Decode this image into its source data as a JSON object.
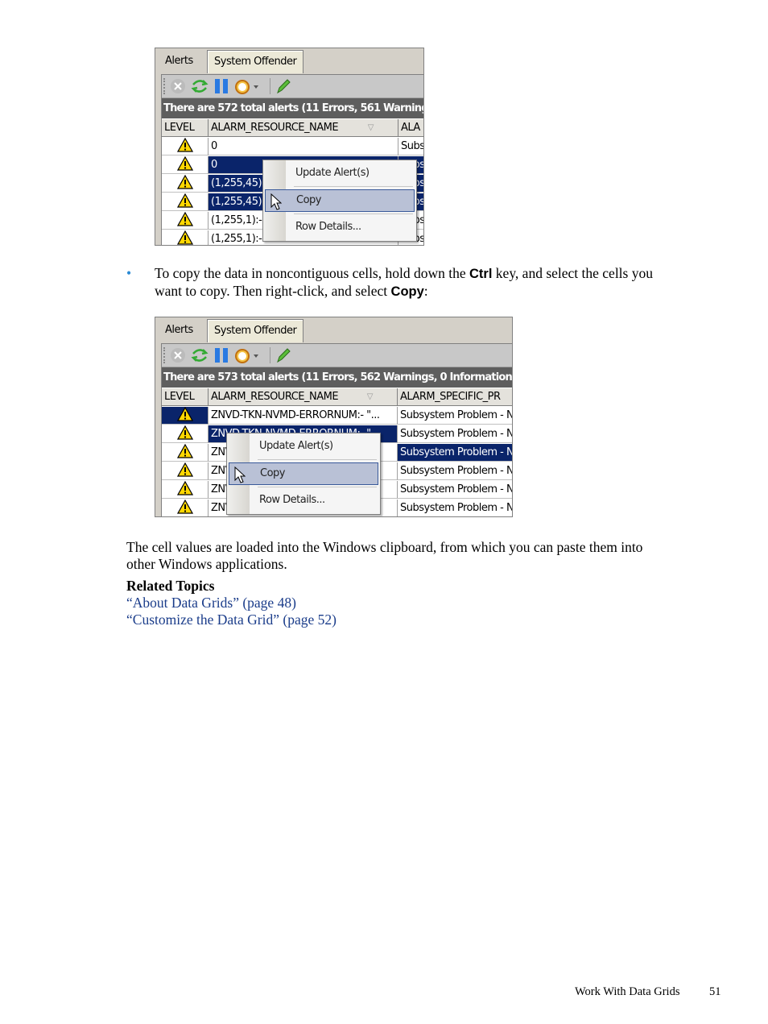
{
  "shot1": {
    "tabs": [
      "Alerts",
      "System Offender"
    ],
    "status": "There are 572 total alerts (11 Errors, 561 Warning",
    "columns": [
      "LEVEL",
      "ALARM_RESOURCE_NAME",
      "ALA"
    ],
    "rows": [
      {
        "name": "0",
        "col3": "Subs",
        "sel": [
          false,
          false,
          false
        ]
      },
      {
        "name": "0",
        "col3": "Subs",
        "sel": [
          false,
          true,
          true
        ]
      },
      {
        "name": "(1,255,45)",
        "col3": "Subs",
        "sel": [
          false,
          true,
          true
        ]
      },
      {
        "name": "(1,255,45)",
        "col3": "Subs",
        "sel": [
          false,
          true,
          true
        ]
      },
      {
        "name": "(1,255,1):-",
        "col3": "Subs",
        "sel": [
          false,
          false,
          false
        ]
      },
      {
        "name": "(1,255,1):- 327 M",
        "col3": "Subs",
        "sel": [
          false,
          false,
          false
        ]
      }
    ],
    "menu": [
      "Update Alert(s)",
      "Copy",
      "Row Details..."
    ]
  },
  "shot2": {
    "tabs": [
      "Alerts",
      "System Offender"
    ],
    "status": "There are 573 total alerts (11 Errors, 562 Warnings, 0 Informational)",
    "columns": [
      "LEVEL",
      "ALARM_RESOURCE_NAME",
      "ALARM_SPECIFIC_PR"
    ],
    "rows": [
      {
        "name": "ZNVD-TKN-NVMD-ERRORNUM:-  \"...",
        "col3": "Subsystem Problem - N",
        "sel": [
          true,
          false,
          false
        ]
      },
      {
        "name": "ZNVD-TKN-NVMD-ERRORNUM:-  \"...",
        "col3": "Subsystem Problem - N",
        "sel": [
          false,
          true,
          false
        ]
      },
      {
        "name": "ZNVD-TKN-NVMD-ERRORNUM:-  \"...",
        "col3": "Subsystem Problem - N",
        "sel": [
          false,
          false,
          true
        ]
      },
      {
        "name": "ZNVD-TKN-NVMD-ERRORNUM:-  \"...",
        "col3": "Subsystem Problem - N",
        "sel": [
          false,
          false,
          false
        ]
      },
      {
        "name": "ZNVD-TKN-NVMD-ERRORNUM:-  \"...",
        "col3": "Subsystem Problem - N",
        "sel": [
          false,
          false,
          false
        ]
      },
      {
        "name": "ZNVD-TKN-NVMD-ERRORNUM:-  \"...",
        "col3": "Subsystem Problem - N",
        "sel": [
          false,
          false,
          false
        ]
      }
    ],
    "menu": [
      "Update Alert(s)",
      "Copy",
      "Row Details..."
    ]
  },
  "text": {
    "bullet_a": "To copy the data in noncontiguous cells, hold down the ",
    "ctrl": "Ctrl",
    "bullet_b": " key, and select the cells you",
    "bullet_c": "want to copy. Then right-click, and select ",
    "copy": "Copy",
    "colon": ":",
    "para1": "The cell values are loaded into the Windows clipboard, from which you can paste them into",
    "para2": "other Windows applications.",
    "related": "Related Topics",
    "link1": "“About Data Grids” (page 48)",
    "link2": "“Customize the Data Grid” (page 52)"
  },
  "footer": {
    "section": "Work With Data Grids",
    "page": "51"
  },
  "colors": {
    "selection": "#0a246a",
    "status_bar": "#5e5e5e",
    "menu_highlight": "#b9c1d6",
    "link": "#1a3c8a",
    "bullet": "#2a8ad4"
  }
}
